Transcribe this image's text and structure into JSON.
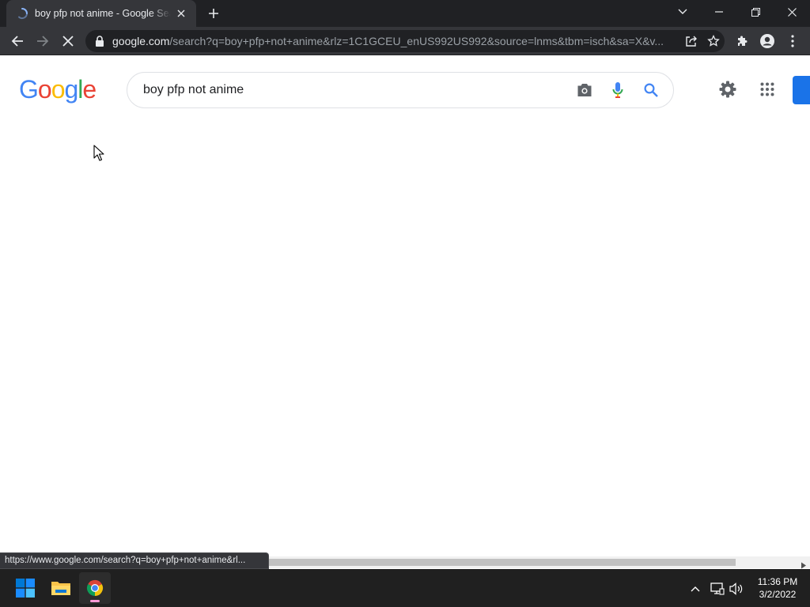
{
  "browser": {
    "tab": {
      "title": "boy pfp not anime - Google Search"
    },
    "address_bar": {
      "host": "google.com",
      "path": "/search?q=boy+pfp+not+anime&rlz=1C1GCEU_enUS992US992&source=lnms&tbm=isch&sa=X&v..."
    },
    "status_url": "https://www.google.com/search?q=boy+pfp+not+anime&rl..."
  },
  "google": {
    "logo_letters": [
      "G",
      "o",
      "o",
      "g",
      "l",
      "e"
    ],
    "search": {
      "query": "boy pfp not anime"
    }
  },
  "colors": {
    "google_blue": "#4285F4",
    "google_red": "#EA4335",
    "google_yellow": "#FBBC05",
    "google_green": "#34A853",
    "signin_blue": "#1A73E8"
  },
  "taskbar": {
    "apps": [
      "windows-start",
      "file-explorer",
      "chrome"
    ],
    "clock": {
      "time": "11:36 PM",
      "date": "3/2/2022"
    }
  }
}
